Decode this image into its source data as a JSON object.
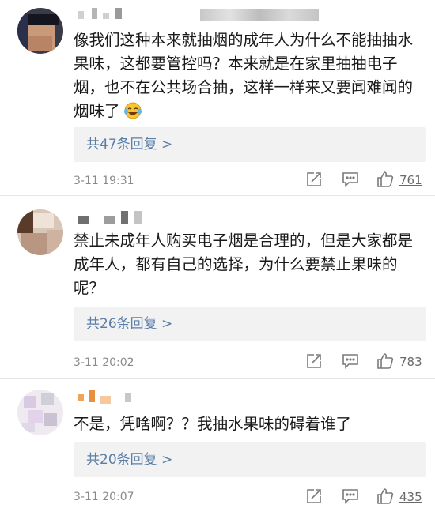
{
  "comments": [
    {
      "text": "像我们这种本来就抽烟的成年人为什么不能抽抽水果味，这都要管控吗？本来就是在家里抽抽电子烟，也不在公共场合抽，这样一样来又要闻难闻的烟味了",
      "emoji_icon": "laugh-cry-emoji",
      "replies_label": "共47条回复 >",
      "time": "3-11 19:31",
      "likes": "761"
    },
    {
      "text": "禁止未成年人购买电子烟是合理的，但是大家都是成年人，都有自己的选择，为什么要禁止果味的呢？",
      "replies_label": "共26条回复 >",
      "time": "3-11 20:02",
      "likes": "783"
    },
    {
      "text": "不是，凭啥啊？？我抽水果味的碍着谁了",
      "replies_label": "共20条回复 >",
      "time": "3-11 20:07",
      "likes": "435"
    }
  ],
  "icons": [
    "share-icon",
    "comment-icon",
    "like-icon"
  ],
  "colors": {
    "link": "#5a7ea8",
    "reply_bg": "#f2f2f2",
    "meta": "#8a8a8a"
  }
}
